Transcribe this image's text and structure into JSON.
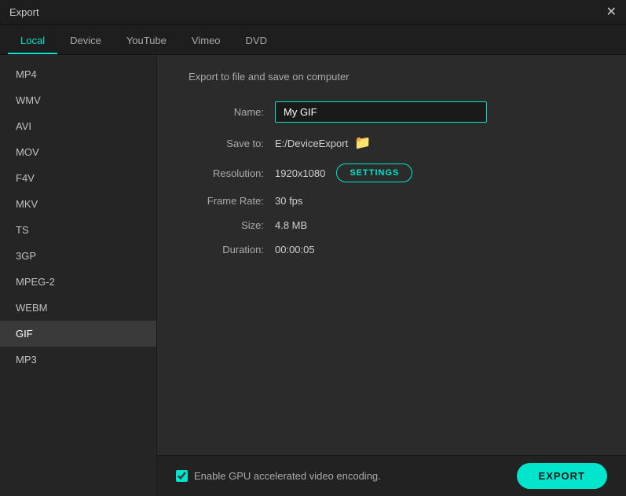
{
  "titleBar": {
    "title": "Export",
    "closeIcon": "✕"
  },
  "tabs": [
    {
      "id": "local",
      "label": "Local",
      "active": true
    },
    {
      "id": "device",
      "label": "Device",
      "active": false
    },
    {
      "id": "youtube",
      "label": "YouTube",
      "active": false
    },
    {
      "id": "vimeo",
      "label": "Vimeo",
      "active": false
    },
    {
      "id": "dvd",
      "label": "DVD",
      "active": false
    }
  ],
  "sidebar": {
    "items": [
      {
        "id": "mp4",
        "label": "MP4",
        "active": false
      },
      {
        "id": "wmv",
        "label": "WMV",
        "active": false
      },
      {
        "id": "avi",
        "label": "AVI",
        "active": false
      },
      {
        "id": "mov",
        "label": "MOV",
        "active": false
      },
      {
        "id": "f4v",
        "label": "F4V",
        "active": false
      },
      {
        "id": "mkv",
        "label": "MKV",
        "active": false
      },
      {
        "id": "ts",
        "label": "TS",
        "active": false
      },
      {
        "id": "3gp",
        "label": "3GP",
        "active": false
      },
      {
        "id": "mpeg2",
        "label": "MPEG-2",
        "active": false
      },
      {
        "id": "webm",
        "label": "WEBM",
        "active": false
      },
      {
        "id": "gif",
        "label": "GIF",
        "active": true
      },
      {
        "id": "mp3",
        "label": "MP3",
        "active": false
      }
    ]
  },
  "content": {
    "exportTitle": "Export to file and save on computer",
    "nameLabel": "Name:",
    "nameValue": "My GIF",
    "saveToLabel": "Save to:",
    "saveToPath": "E:/DeviceExport",
    "resolutionLabel": "Resolution:",
    "resolutionValue": "1920x1080",
    "settingsButtonLabel": "SETTINGS",
    "frameRateLabel": "Frame Rate:",
    "frameRateValue": "30 fps",
    "sizeLabel": "Size:",
    "sizeValue": "4.8 MB",
    "durationLabel": "Duration:",
    "durationValue": "00:00:05"
  },
  "bottomBar": {
    "gpuLabel": "Enable GPU accelerated video encoding.",
    "exportButtonLabel": "EXPORT"
  }
}
